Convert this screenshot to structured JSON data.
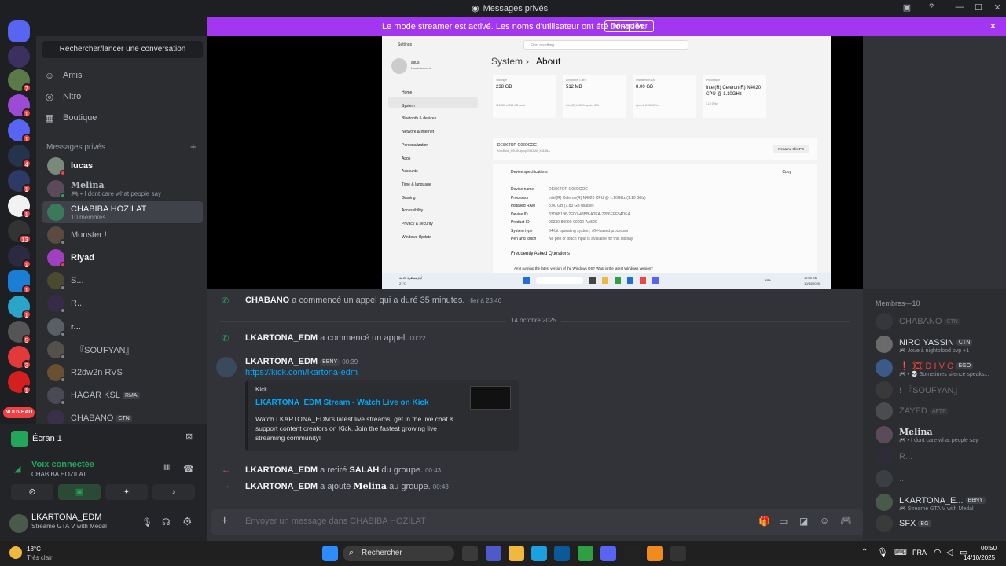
{
  "window": {
    "title": "Messages privés"
  },
  "banner": {
    "text": "Le mode streamer est activé. Les noms d'utilisateur ont été tronqués.",
    "button": "Désactiver"
  },
  "guilds": {
    "badges": [
      "7",
      "1",
      "1",
      "4",
      "1",
      "1",
      "1",
      "13",
      "1",
      "1",
      "1",
      "5",
      "3",
      "1"
    ],
    "new_label": "NOUVEAU"
  },
  "sidebar": {
    "search_label": "Rechercher/lancer une conversation",
    "nav": [
      "Amis",
      "Nitro",
      "Boutique"
    ],
    "dm_header": "Messages privés",
    "dms": [
      {
        "name": "lucas",
        "sub": ""
      },
      {
        "name": "Melina",
        "sub": "🎮 • I dont care what people say"
      },
      {
        "name": "CHABIBA HOZILAT",
        "sub": "10 membres"
      },
      {
        "name": "Monster !",
        "sub": ""
      },
      {
        "name": "Riyad",
        "sub": ""
      },
      {
        "name": "S...",
        "sub": ""
      },
      {
        "name": "R...",
        "sub": ""
      },
      {
        "name": "r...",
        "sub": ""
      },
      {
        "name": "! 『SOUFYAN』",
        "sub": ""
      },
      {
        "name": "R2dw2n RVS",
        "sub": ""
      },
      {
        "name": "HAGAR KSL",
        "sub": "",
        "tag": "RMA"
      },
      {
        "name": "CHABANO",
        "sub": "",
        "tag": "CTN"
      }
    ]
  },
  "screen": {
    "label": "Écran 1"
  },
  "voice": {
    "status": "Voix connectée",
    "channel": "CHABIBA HOZILAT"
  },
  "user": {
    "name": "LKARTONA_EDM",
    "status": "Streame GTA V with Medal"
  },
  "shot": {
    "search": "Find a setting",
    "settings": "Settings",
    "account_name": "asus",
    "account_type": "Local Account",
    "crumb1": "System",
    "crumb2": "About",
    "nav": [
      "Home",
      "System",
      "Bluetooth & devices",
      "Network & internet",
      "Personalization",
      "Apps",
      "Accounts",
      "Time & language",
      "Gaming",
      "Accessibility",
      "Privacy & security",
      "Windows Update"
    ],
    "cards": [
      {
        "title": "Storage",
        "value": "238 GB",
        "sub": "116 GB of 238 GB used"
      },
      {
        "title": "Graphics Card",
        "value": "512 MB",
        "sub": "Intel(R) UHD Graphics 600"
      },
      {
        "title": "Installed RAM",
        "value": "8.00 GB",
        "sub": "Speed: 2400 MT/s"
      },
      {
        "title": "Processor",
        "value": "Intel(R) Celeron(R) N4020 CPU @ 1.10GHz",
        "sub": "1.10 GHz"
      }
    ],
    "device_name": "DESKTOP-G06OCOC",
    "device_model": "VivoBook_ASUSLaptop X543MA_X543MA",
    "rename": "Rename this PC",
    "spec_title": "Device specifications",
    "copy": "Copy",
    "specs": [
      [
        "Device name",
        "DESKTOP-G06OCOC"
      ],
      [
        "Processor",
        "Intel(R) Celeron(R) N4020 CPU @ 1.10GHz (1.10 GHz)"
      ],
      [
        "Installed RAM",
        "8.00 GB (7.83 GB usable)"
      ],
      [
        "Device ID",
        "83D4B196-2FD1-43BB-A0EA-7286EFF54DE4"
      ],
      [
        "Product ID",
        "00330-80000-00000-AA529"
      ],
      [
        "System type",
        "64-bit operating system, x64-based processor"
      ],
      [
        "Pen and touch",
        "No pen or touch input is available for this display"
      ]
    ],
    "faq": "Frequently Asked Questions",
    "faq_q": "Am I running the latest version of the Windows OS? What is the latest Windows version?",
    "tb_weather": "أيام ممطرة قادمة",
    "tb_temp": "21°C",
    "tb_lang": "FRA",
    "tb_time": "12:50 AM",
    "tb_date": "10/14/2025"
  },
  "messages": {
    "call1": {
      "user": "CHABANO",
      "text": "a commencé un appel qui a duré 35 minutes.",
      "time": "Hier à 23:46"
    },
    "date_divider": "14 octobre 2025",
    "call2": {
      "user": "LKARTONA_EDM",
      "text": "a commencé un appel.",
      "time": "00:22"
    },
    "post": {
      "user": "LKARTONA_EDM",
      "tag": "BBNY",
      "time": "00:39",
      "link": "https://kick.com/lkartona-edm"
    },
    "embed": {
      "provider": "Kick",
      "title": "LKARTONA_EDM Stream - Watch Live on Kick",
      "desc": "Watch LKARTONA_EDM's latest live streams, get in the live chat & support content creators on Kick. Join the fastest growing live streaming community!"
    },
    "removed": {
      "user": "LKARTONA_EDM",
      "text1": "a retiré",
      "target": "SALAH",
      "text2": "du groupe.",
      "time": "00:43"
    },
    "added": {
      "user": "LKARTONA_EDM",
      "text1": "a ajouté",
      "target": "Melina",
      "text2": "au groupe.",
      "time": "00:43"
    }
  },
  "composer": {
    "placeholder": "Envoyer un message dans CHABIBA HOZILAT"
  },
  "members": {
    "header": "Membres—10",
    "list": [
      {
        "name": "CHABANO",
        "tag": "CTN",
        "sub": ""
      },
      {
        "name": "NIRO YASSIN",
        "tag": "CTN",
        "sub": "🎮 Joue à nightblood pvp +1"
      },
      {
        "name": "❗ 💢 D I V O",
        "tag": "EGO",
        "sub": "🎮 • 💀 Sometimes silence speaks..."
      },
      {
        "name": "! 『SOUFYAN』",
        "tag": "",
        "sub": ""
      },
      {
        "name": "ZAYED",
        "tag": "AFTR",
        "sub": ""
      },
      {
        "name": "Melina",
        "tag": "",
        "sub": "🎮 • I dont care what people say"
      },
      {
        "name": "R...",
        "tag": "",
        "sub": ""
      },
      {
        "name": "...",
        "tag": "",
        "sub": ""
      },
      {
        "name": "LKARTONA_E...",
        "tag": "BBNY",
        "sub": "🎮 Streame GTA V with Medal"
      },
      {
        "name": "SFX",
        "tag": "BG",
        "sub": ""
      }
    ]
  },
  "taskbar": {
    "weather_temp": "18°C",
    "weather_desc": "Très clair",
    "search": "Rechercher",
    "lang": "FRA",
    "time": "00:50",
    "date": "14/10/2025"
  }
}
